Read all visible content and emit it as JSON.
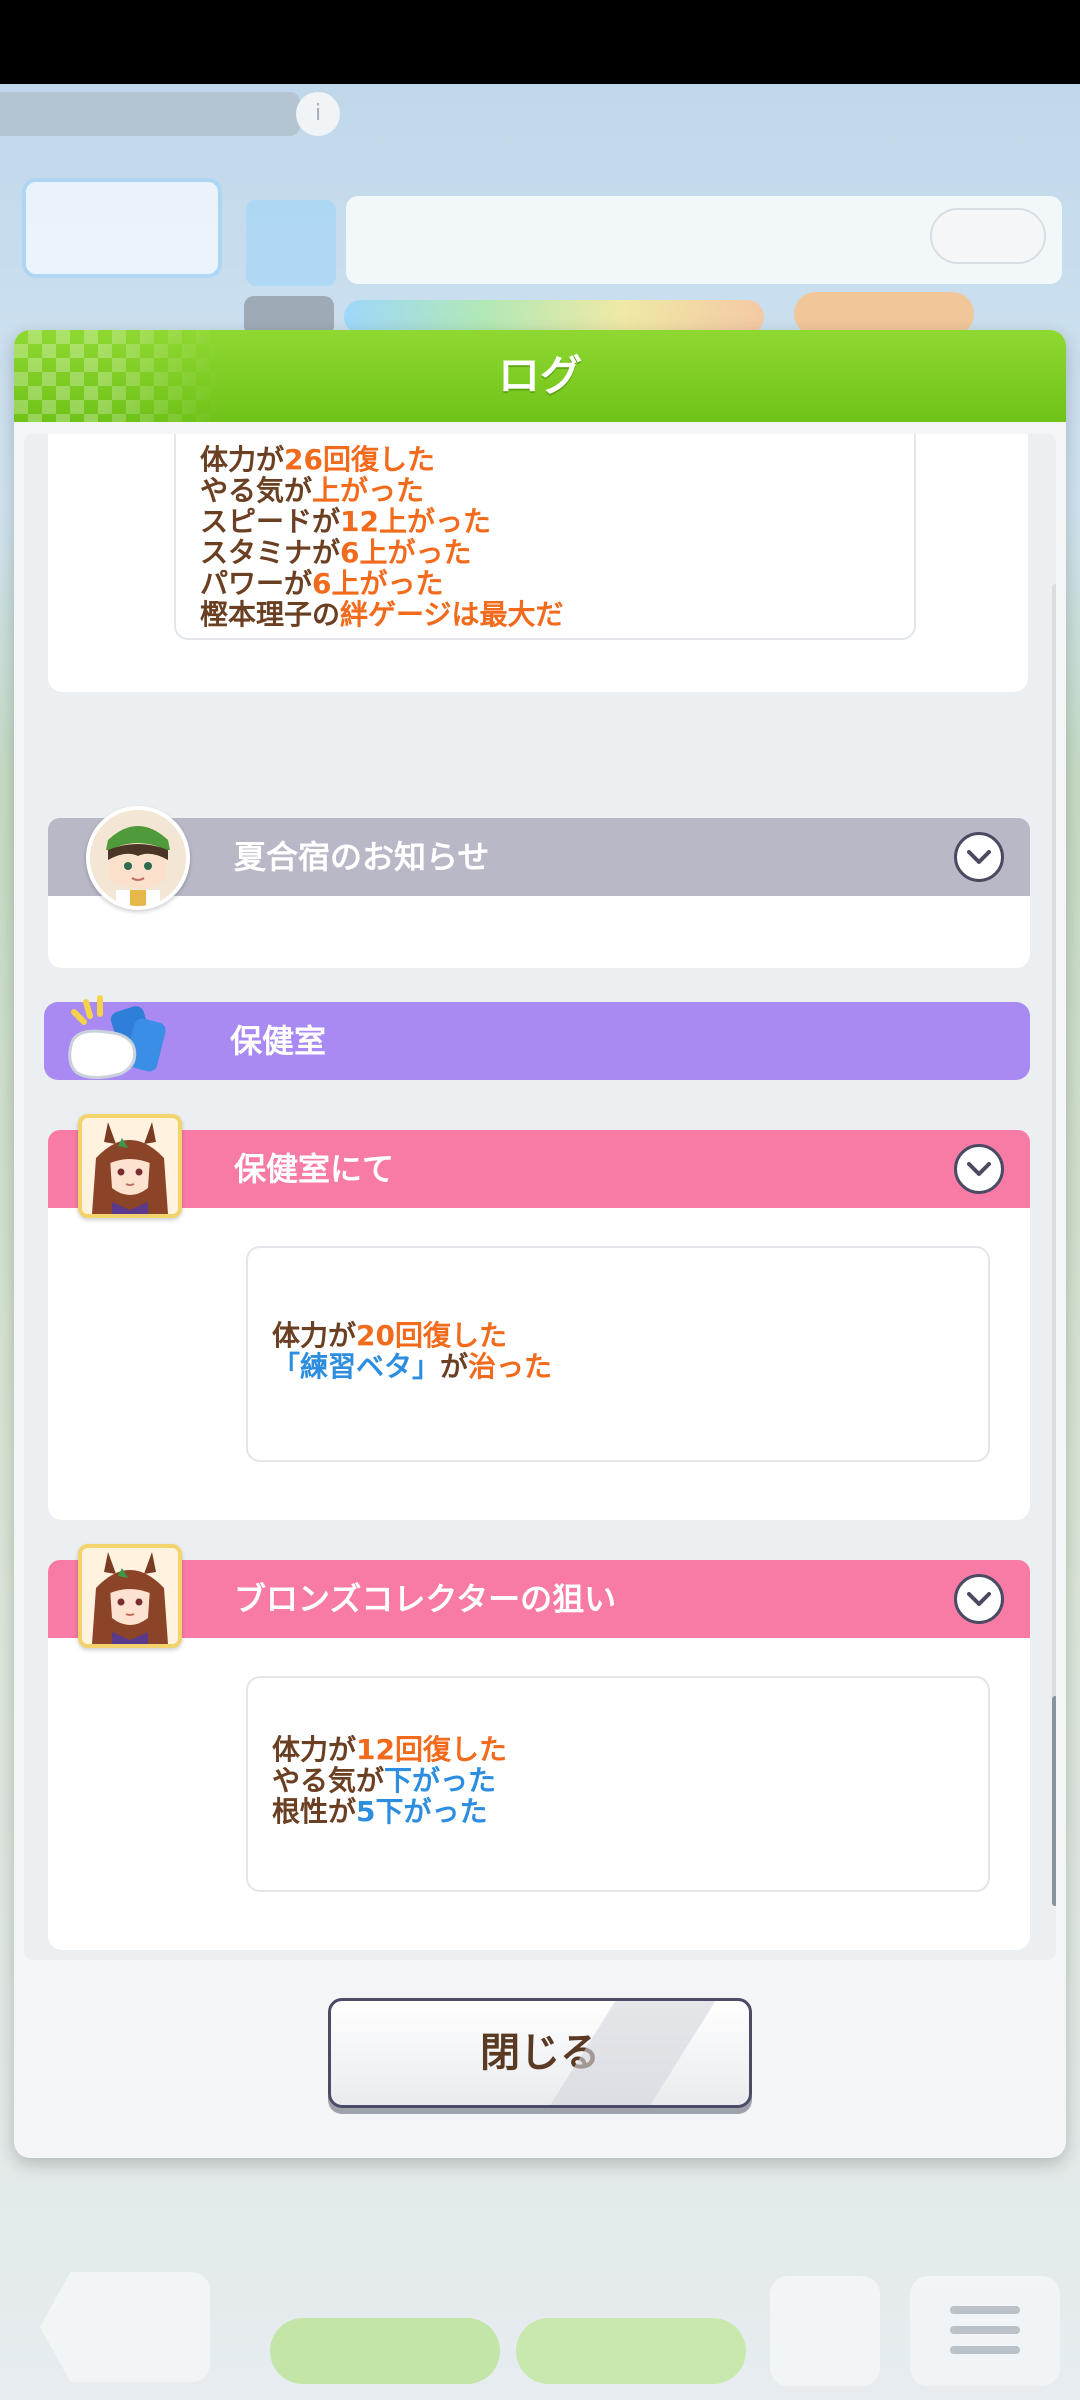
{
  "modal": {
    "title": "ログ",
    "close_label": "閉じる"
  },
  "log": {
    "entry_top": {
      "lines": [
        {
          "parts": [
            {
              "t": "体力が",
              "c": "n"
            },
            {
              "t": "26回復した",
              "c": "h"
            }
          ]
        },
        {
          "parts": [
            {
              "t": "やる気が",
              "c": "n"
            },
            {
              "t": "上がった",
              "c": "h"
            }
          ]
        },
        {
          "parts": [
            {
              "t": "スピードが",
              "c": "n"
            },
            {
              "t": "12上がった",
              "c": "h"
            }
          ]
        },
        {
          "parts": [
            {
              "t": "スタミナが",
              "c": "n"
            },
            {
              "t": "6上がった",
              "c": "h"
            }
          ]
        },
        {
          "parts": [
            {
              "t": "パワーが",
              "c": "n"
            },
            {
              "t": "6上がった",
              "c": "h"
            }
          ]
        },
        {
          "parts": [
            {
              "t": "樫本理子の",
              "c": "n"
            },
            {
              "t": "絆ゲージは最大だ",
              "c": "h"
            }
          ]
        }
      ]
    },
    "entry_summer": {
      "title": "夏合宿のお知らせ",
      "icon": "trainer-portrait-icon"
    },
    "section_infirmary": {
      "title": "保健室",
      "icon": "pillow-drink-icon"
    },
    "entry_infirmary": {
      "title": "保健室にて",
      "icon": "horse-girl-portrait-icon",
      "lines": [
        {
          "parts": [
            {
              "t": "体力が",
              "c": "n"
            },
            {
              "t": "20回復した",
              "c": "h"
            }
          ]
        },
        {
          "parts": [
            {
              "t": "「練習ベタ」",
              "c": "b"
            },
            {
              "t": "が",
              "c": "n"
            },
            {
              "t": "治った",
              "c": "h"
            }
          ]
        }
      ]
    },
    "entry_bronze": {
      "title": "ブロンズコレクターの狙い",
      "icon": "horse-girl-portrait-icon",
      "lines": [
        {
          "parts": [
            {
              "t": "体力が",
              "c": "n"
            },
            {
              "t": "12回復した",
              "c": "h"
            }
          ]
        },
        {
          "parts": [
            {
              "t": "やる気が",
              "c": "n"
            },
            {
              "t": "下がった",
              "c": "b"
            }
          ]
        },
        {
          "parts": [
            {
              "t": "根性が",
              "c": "n"
            },
            {
              "t": "5下がった",
              "c": "b"
            }
          ]
        }
      ]
    }
  },
  "colors": {
    "header_green": "#7ccd22",
    "highlight_orange": "#f26a1b",
    "decrease_blue": "#2d8ee0",
    "text_brown": "#6b3f22",
    "bar_gray": "#b9b8c6",
    "bar_purple": "#a98af2",
    "bar_pink": "#f87ba5"
  }
}
